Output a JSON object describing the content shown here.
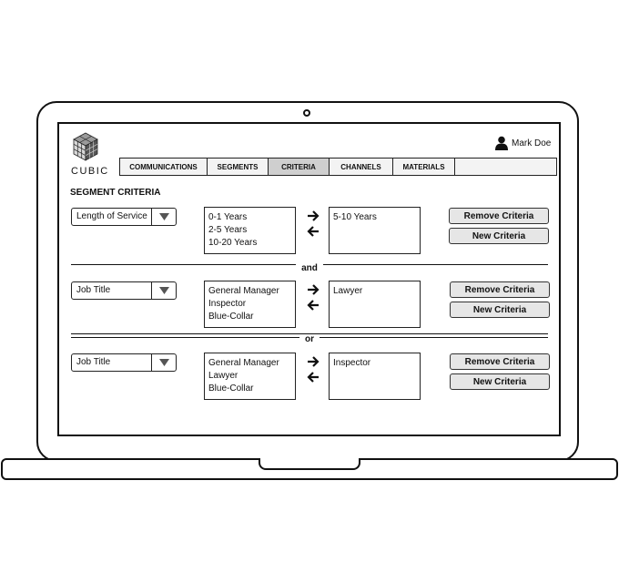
{
  "app": {
    "logo_text": "CUBIC"
  },
  "user": {
    "name": "Mark Doe"
  },
  "tabs": [
    {
      "label": "COMMUNICATIONS"
    },
    {
      "label": "SEGMENTS"
    },
    {
      "label": "CRITERIA",
      "active": true
    },
    {
      "label": "CHANNELS"
    },
    {
      "label": "MATERIALS"
    }
  ],
  "section": {
    "title": "SEGMENT CRITERIA"
  },
  "criteria": [
    {
      "field": "Length of Service",
      "available": [
        "0-1 Years",
        "2-5 Years",
        "10-20 Years"
      ],
      "selected": [
        "5-10 Years"
      ],
      "remove_label": "Remove Criteria",
      "new_label": "New Criteria"
    },
    {
      "field": "Job Title",
      "available": [
        "General Manager",
        "Inspector",
        "Blue-Collar"
      ],
      "selected": [
        "Lawyer"
      ],
      "remove_label": "Remove Criteria",
      "new_label": "New Criteria"
    },
    {
      "field": "Job Title",
      "available": [
        "General Manager",
        "Lawyer",
        "Blue-Collar"
      ],
      "selected": [
        "Inspector"
      ],
      "remove_label": "Remove Criteria",
      "new_label": "New Criteria"
    }
  ],
  "separators": [
    {
      "label": "and"
    },
    {
      "label": "or"
    }
  ],
  "icons": {
    "logo": "cube-logo-icon",
    "user": "user-icon",
    "dropdown": "triangle-down-icon",
    "move_right": "arrow-right-icon",
    "move_left": "arrow-left-icon"
  }
}
